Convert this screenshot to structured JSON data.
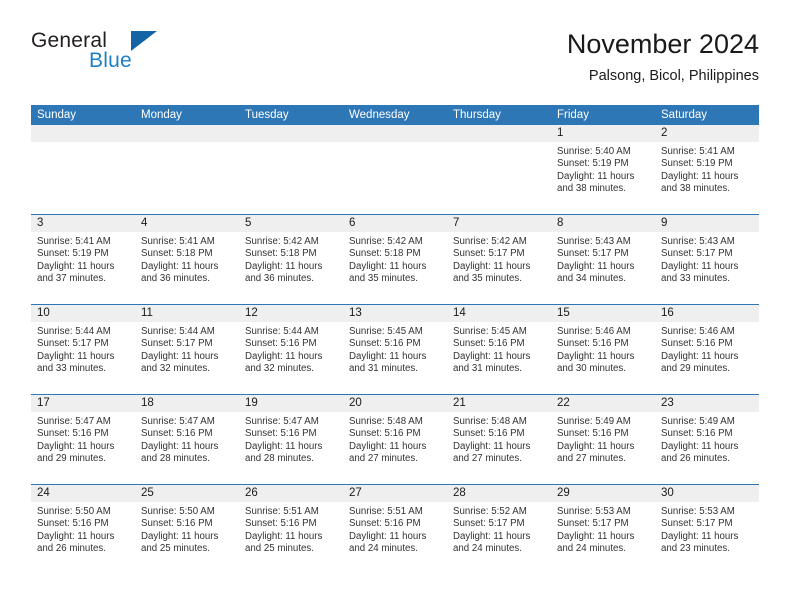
{
  "brand": {
    "name_part1": "General",
    "name_part2": "Blue",
    "logo_icon": "blue-triangle-icon",
    "accent_color": "#1f7fc4",
    "header_color": "#2e77b6"
  },
  "header": {
    "title": "November 2024",
    "location": "Palsong, Bicol, Philippines"
  },
  "weekdays": [
    "Sunday",
    "Monday",
    "Tuesday",
    "Wednesday",
    "Thursday",
    "Friday",
    "Saturday"
  ],
  "weeks": [
    {
      "days": [
        {
          "num": "",
          "sunrise": "",
          "sunset": "",
          "daylight": ""
        },
        {
          "num": "",
          "sunrise": "",
          "sunset": "",
          "daylight": ""
        },
        {
          "num": "",
          "sunrise": "",
          "sunset": "",
          "daylight": ""
        },
        {
          "num": "",
          "sunrise": "",
          "sunset": "",
          "daylight": ""
        },
        {
          "num": "",
          "sunrise": "",
          "sunset": "",
          "daylight": ""
        },
        {
          "num": "1",
          "sunrise": "Sunrise: 5:40 AM",
          "sunset": "Sunset: 5:19 PM",
          "daylight": "Daylight: 11 hours and 38 minutes."
        },
        {
          "num": "2",
          "sunrise": "Sunrise: 5:41 AM",
          "sunset": "Sunset: 5:19 PM",
          "daylight": "Daylight: 11 hours and 38 minutes."
        }
      ]
    },
    {
      "days": [
        {
          "num": "3",
          "sunrise": "Sunrise: 5:41 AM",
          "sunset": "Sunset: 5:19 PM",
          "daylight": "Daylight: 11 hours and 37 minutes."
        },
        {
          "num": "4",
          "sunrise": "Sunrise: 5:41 AM",
          "sunset": "Sunset: 5:18 PM",
          "daylight": "Daylight: 11 hours and 36 minutes."
        },
        {
          "num": "5",
          "sunrise": "Sunrise: 5:42 AM",
          "sunset": "Sunset: 5:18 PM",
          "daylight": "Daylight: 11 hours and 36 minutes."
        },
        {
          "num": "6",
          "sunrise": "Sunrise: 5:42 AM",
          "sunset": "Sunset: 5:18 PM",
          "daylight": "Daylight: 11 hours and 35 minutes."
        },
        {
          "num": "7",
          "sunrise": "Sunrise: 5:42 AM",
          "sunset": "Sunset: 5:17 PM",
          "daylight": "Daylight: 11 hours and 35 minutes."
        },
        {
          "num": "8",
          "sunrise": "Sunrise: 5:43 AM",
          "sunset": "Sunset: 5:17 PM",
          "daylight": "Daylight: 11 hours and 34 minutes."
        },
        {
          "num": "9",
          "sunrise": "Sunrise: 5:43 AM",
          "sunset": "Sunset: 5:17 PM",
          "daylight": "Daylight: 11 hours and 33 minutes."
        }
      ]
    },
    {
      "days": [
        {
          "num": "10",
          "sunrise": "Sunrise: 5:44 AM",
          "sunset": "Sunset: 5:17 PM",
          "daylight": "Daylight: 11 hours and 33 minutes."
        },
        {
          "num": "11",
          "sunrise": "Sunrise: 5:44 AM",
          "sunset": "Sunset: 5:17 PM",
          "daylight": "Daylight: 11 hours and 32 minutes."
        },
        {
          "num": "12",
          "sunrise": "Sunrise: 5:44 AM",
          "sunset": "Sunset: 5:16 PM",
          "daylight": "Daylight: 11 hours and 32 minutes."
        },
        {
          "num": "13",
          "sunrise": "Sunrise: 5:45 AM",
          "sunset": "Sunset: 5:16 PM",
          "daylight": "Daylight: 11 hours and 31 minutes."
        },
        {
          "num": "14",
          "sunrise": "Sunrise: 5:45 AM",
          "sunset": "Sunset: 5:16 PM",
          "daylight": "Daylight: 11 hours and 31 minutes."
        },
        {
          "num": "15",
          "sunrise": "Sunrise: 5:46 AM",
          "sunset": "Sunset: 5:16 PM",
          "daylight": "Daylight: 11 hours and 30 minutes."
        },
        {
          "num": "16",
          "sunrise": "Sunrise: 5:46 AM",
          "sunset": "Sunset: 5:16 PM",
          "daylight": "Daylight: 11 hours and 29 minutes."
        }
      ]
    },
    {
      "days": [
        {
          "num": "17",
          "sunrise": "Sunrise: 5:47 AM",
          "sunset": "Sunset: 5:16 PM",
          "daylight": "Daylight: 11 hours and 29 minutes."
        },
        {
          "num": "18",
          "sunrise": "Sunrise: 5:47 AM",
          "sunset": "Sunset: 5:16 PM",
          "daylight": "Daylight: 11 hours and 28 minutes."
        },
        {
          "num": "19",
          "sunrise": "Sunrise: 5:47 AM",
          "sunset": "Sunset: 5:16 PM",
          "daylight": "Daylight: 11 hours and 28 minutes."
        },
        {
          "num": "20",
          "sunrise": "Sunrise: 5:48 AM",
          "sunset": "Sunset: 5:16 PM",
          "daylight": "Daylight: 11 hours and 27 minutes."
        },
        {
          "num": "21",
          "sunrise": "Sunrise: 5:48 AM",
          "sunset": "Sunset: 5:16 PM",
          "daylight": "Daylight: 11 hours and 27 minutes."
        },
        {
          "num": "22",
          "sunrise": "Sunrise: 5:49 AM",
          "sunset": "Sunset: 5:16 PM",
          "daylight": "Daylight: 11 hours and 27 minutes."
        },
        {
          "num": "23",
          "sunrise": "Sunrise: 5:49 AM",
          "sunset": "Sunset: 5:16 PM",
          "daylight": "Daylight: 11 hours and 26 minutes."
        }
      ]
    },
    {
      "days": [
        {
          "num": "24",
          "sunrise": "Sunrise: 5:50 AM",
          "sunset": "Sunset: 5:16 PM",
          "daylight": "Daylight: 11 hours and 26 minutes."
        },
        {
          "num": "25",
          "sunrise": "Sunrise: 5:50 AM",
          "sunset": "Sunset: 5:16 PM",
          "daylight": "Daylight: 11 hours and 25 minutes."
        },
        {
          "num": "26",
          "sunrise": "Sunrise: 5:51 AM",
          "sunset": "Sunset: 5:16 PM",
          "daylight": "Daylight: 11 hours and 25 minutes."
        },
        {
          "num": "27",
          "sunrise": "Sunrise: 5:51 AM",
          "sunset": "Sunset: 5:16 PM",
          "daylight": "Daylight: 11 hours and 24 minutes."
        },
        {
          "num": "28",
          "sunrise": "Sunrise: 5:52 AM",
          "sunset": "Sunset: 5:17 PM",
          "daylight": "Daylight: 11 hours and 24 minutes."
        },
        {
          "num": "29",
          "sunrise": "Sunrise: 5:53 AM",
          "sunset": "Sunset: 5:17 PM",
          "daylight": "Daylight: 11 hours and 24 minutes."
        },
        {
          "num": "30",
          "sunrise": "Sunrise: 5:53 AM",
          "sunset": "Sunset: 5:17 PM",
          "daylight": "Daylight: 11 hours and 23 minutes."
        }
      ]
    }
  ]
}
